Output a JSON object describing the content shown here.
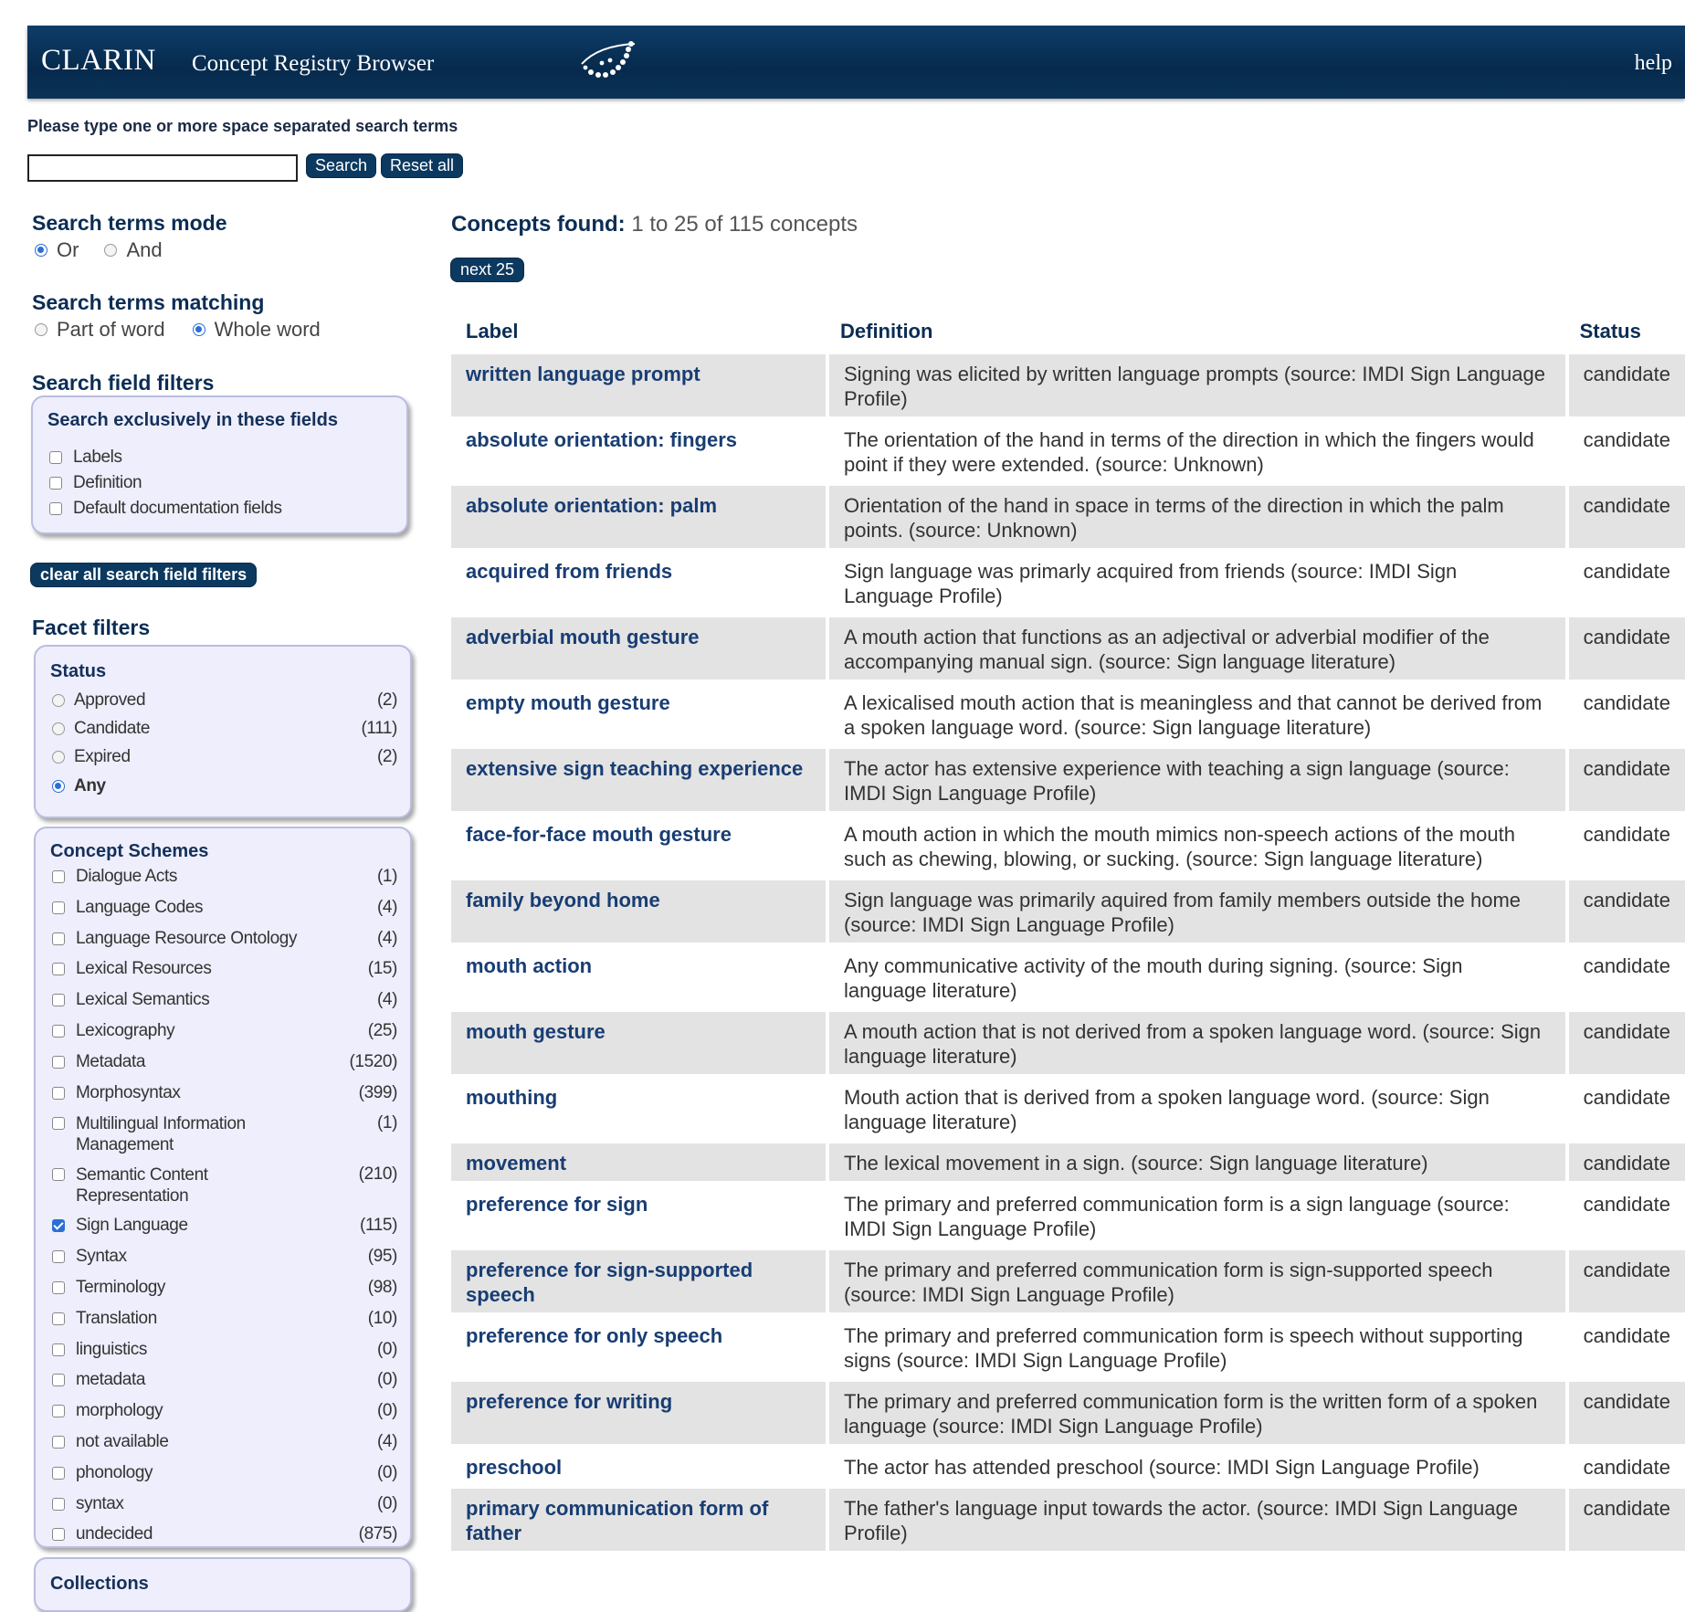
{
  "header": {
    "brand": "CLARIN",
    "title": "Concept Registry Browser",
    "help": "help"
  },
  "search": {
    "hint": "Please type one or more space separated search terms",
    "value": "",
    "search_label": "Search",
    "reset_label": "Reset all"
  },
  "mode": {
    "title": "Search terms mode",
    "options": [
      "Or",
      "And"
    ],
    "selected": "Or"
  },
  "matching": {
    "title": "Search terms matching",
    "options": [
      "Part of word",
      "Whole word"
    ],
    "selected": "Whole word"
  },
  "field_filters": {
    "title": "Search field filters",
    "box_title": "Search exclusively in these fields",
    "fields": [
      "Labels",
      "Definition",
      "Default documentation fields"
    ],
    "clear_label": "clear all search field filters"
  },
  "facets": {
    "title": "Facet filters",
    "status": {
      "title": "Status",
      "options": [
        {
          "label": "Approved",
          "count": "(2)"
        },
        {
          "label": "Candidate",
          "count": "(111)"
        },
        {
          "label": "Expired",
          "count": "(2)"
        },
        {
          "label": "Any",
          "count": ""
        }
      ],
      "selected": "Any"
    },
    "schemes": {
      "title": "Concept Schemes",
      "items": [
        {
          "label": "Dialogue Acts",
          "count": "(1)"
        },
        {
          "label": "Language Codes",
          "count": "(4)"
        },
        {
          "label": "Language Resource Ontology",
          "count": "(4)"
        },
        {
          "label": "Lexical Resources",
          "count": "(15)"
        },
        {
          "label": "Lexical Semantics",
          "count": "(4)"
        },
        {
          "label": "Lexicography",
          "count": "(25)"
        },
        {
          "label": "Metadata",
          "count": "(1520)"
        },
        {
          "label": "Morphosyntax",
          "count": "(399)"
        },
        {
          "label": "Multilingual Information Management",
          "count": "(1)"
        },
        {
          "label": "Semantic Content Representation",
          "count": "(210)"
        },
        {
          "label": "Sign Language",
          "count": "(115)",
          "checked": true
        },
        {
          "label": "Syntax",
          "count": "(95)"
        },
        {
          "label": "Terminology",
          "count": "(98)"
        },
        {
          "label": "Translation",
          "count": "(10)"
        },
        {
          "label": "linguistics",
          "count": "(0)"
        },
        {
          "label": "metadata",
          "count": "(0)"
        },
        {
          "label": "morphology",
          "count": "(0)"
        },
        {
          "label": "not available",
          "count": "(4)"
        },
        {
          "label": "phonology",
          "count": "(0)"
        },
        {
          "label": "syntax",
          "count": "(0)"
        },
        {
          "label": "undecided",
          "count": "(875)"
        }
      ]
    },
    "collections": {
      "title": "Collections"
    }
  },
  "results": {
    "found_label": "Concepts found:",
    "found_text": "1 to 25 of 115 concepts",
    "next_label": "next 25",
    "columns": [
      "Label",
      "Definition",
      "Status"
    ],
    "rows": [
      {
        "label": "written language prompt",
        "definition": "Signing was elicited by written language prompts (source: IMDI Sign Language Profile)",
        "status": "candidate"
      },
      {
        "label": "absolute orientation: fingers",
        "definition": "The orientation of the hand in terms of the direction in which the fingers would point if they were extended. (source: Unknown)",
        "status": "candidate"
      },
      {
        "label": "absolute orientation: palm",
        "definition": "Orientation of the hand in space in terms of the direction in which the palm points. (source: Unknown)",
        "status": "candidate"
      },
      {
        "label": "acquired from friends",
        "definition": "Sign language was primarly acquired from friends (source: IMDI Sign Language Profile)",
        "status": "candidate"
      },
      {
        "label": "adverbial mouth gesture",
        "definition": "A mouth action that functions as an adjectival or adverbial modifier of the accompanying manual sign. (source: Sign language literature)",
        "status": "candidate"
      },
      {
        "label": "empty mouth gesture",
        "definition": "A lexicalised mouth action that is meaningless and that cannot be derived from a spoken language word. (source: Sign language literature)",
        "status": "candidate"
      },
      {
        "label": "extensive sign teaching experience",
        "definition": "The actor has extensive experience with teaching a sign language (source: IMDI Sign Language Profile)",
        "status": "candidate"
      },
      {
        "label": "face-for-face mouth gesture",
        "definition": "A mouth action in which the mouth mimics non-speech actions of the mouth such as chewing, blowing, or sucking. (source: Sign language literature)",
        "status": "candidate"
      },
      {
        "label": "family beyond home",
        "definition": "Sign language was primarily aquired from family members outside the home (source: IMDI Sign Language Profile)",
        "status": "candidate"
      },
      {
        "label": "mouth action",
        "definition": "Any communicative activity of the mouth during signing. (source: Sign language literature)",
        "status": "candidate"
      },
      {
        "label": "mouth gesture",
        "definition": "A mouth action that is not derived from a spoken language word. (source: Sign language literature)",
        "status": "candidate"
      },
      {
        "label": "mouthing",
        "definition": "Mouth action that is derived from a spoken language word. (source: Sign language literature)",
        "status": "candidate"
      },
      {
        "label": "movement",
        "definition": "The lexical movement in a sign. (source: Sign language literature)",
        "status": "candidate"
      },
      {
        "label": "preference for sign",
        "definition": "The primary and preferred communication form is a sign language (source: IMDI Sign Language Profile)",
        "status": "candidate"
      },
      {
        "label": "preference for sign-supported speech",
        "definition": "The primary and preferred communication form is sign-supported speech (source: IMDI Sign Language Profile)",
        "status": "candidate"
      },
      {
        "label": "preference for only speech",
        "definition": "The primary and preferred communication form is speech without supporting signs (source: IMDI Sign Language Profile)",
        "status": "candidate"
      },
      {
        "label": "preference for writing",
        "definition": "The primary and preferred communication form is the written form of a spoken language (source: IMDI Sign Language Profile)",
        "status": "candidate"
      },
      {
        "label": "preschool",
        "definition": "The actor has attended preschool (source: IMDI Sign Language Profile)",
        "status": "candidate"
      },
      {
        "label": "primary communication form of father",
        "definition": "The father's language input towards the actor. (source: IMDI Sign Language Profile)",
        "status": "candidate"
      }
    ]
  }
}
